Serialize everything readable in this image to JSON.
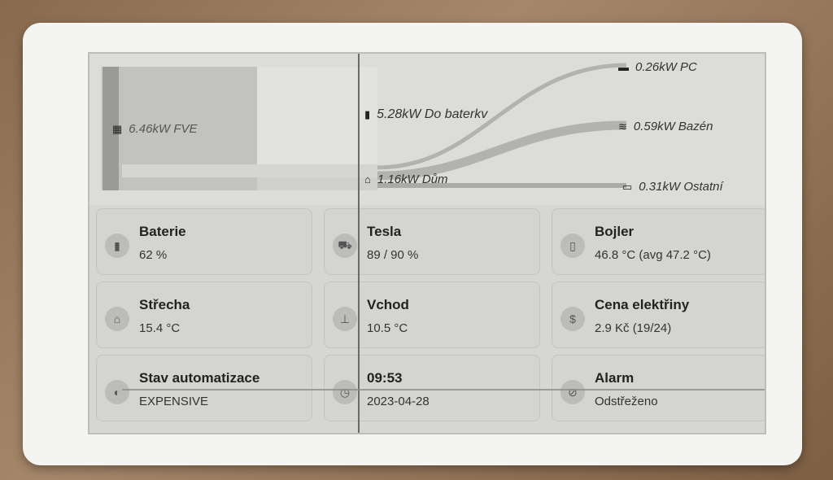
{
  "flow": {
    "source": {
      "value": "6.46kW FVE",
      "icon": "solar-panel-icon"
    },
    "battery": {
      "value": "5.28kW Do baterkv",
      "icon": "battery-icon"
    },
    "house": {
      "value": "1.16kW Dům",
      "icon": "home-icon"
    },
    "pc": {
      "value": "0.26kW PC",
      "icon": "desktop-icon"
    },
    "pool": {
      "value": "0.59kW Bazén",
      "icon": "pool-icon"
    },
    "other": {
      "value": "0.31kW Ostatní",
      "icon": "plug-icon"
    }
  },
  "cards": {
    "baterie": {
      "title": "Baterie",
      "value": "62 %",
      "icon": "battery-icon"
    },
    "tesla": {
      "title": "Tesla",
      "value": "89 / 90 %",
      "icon": "car-icon"
    },
    "bojler": {
      "title": "Bojler",
      "value": "46.8 °C (avg 47.2 °C)",
      "icon": "water-heater-icon"
    },
    "strecha": {
      "title": "Střecha",
      "value": "15.4 °C",
      "icon": "roof-icon"
    },
    "vchod": {
      "title": "Vchod",
      "value": "10.5 °C",
      "icon": "thermometer-icon"
    },
    "cena": {
      "title": "Cena elektřiny",
      "value": "2.9 Kč (19/24)",
      "icon": "currency-icon"
    },
    "automatizace": {
      "title": "Stav automatizace",
      "value": "EXPENSIVE",
      "icon": "robot-icon"
    },
    "cas": {
      "title": "09:53",
      "value": "2023-04-28",
      "icon": "clock-icon"
    },
    "alarm": {
      "title": "Alarm",
      "value": "Odstřeženo",
      "icon": "shield-off-icon"
    }
  }
}
